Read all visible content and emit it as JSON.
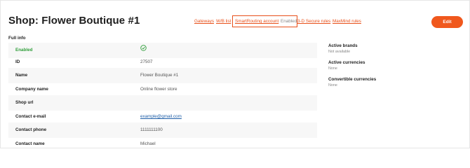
{
  "header": {
    "title": "Shop: Flower Boutique #1",
    "edit_label": "Edit"
  },
  "links": {
    "gateways": "Gateways",
    "wb_list": "W/B list",
    "smartrouting": "SmartRouting account",
    "smartrouting_status": "Enabled",
    "secure_rules": "3-D Secure rules",
    "maxmind_rules": "MaxMind rules"
  },
  "full_info": {
    "title": "Full info",
    "rows": [
      {
        "label": "Enabled",
        "value": "",
        "icon": "check-circle-icon"
      },
      {
        "label": "ID",
        "value": "27507"
      },
      {
        "label": "Name",
        "value": "Flower Boutique #1"
      },
      {
        "label": "Company name",
        "value": "Online flower store"
      },
      {
        "label": "Shop url",
        "value": ""
      },
      {
        "label": "Contact e-mail",
        "value": "example@gmail.com"
      },
      {
        "label": "Contact phone",
        "value": "1111111100"
      },
      {
        "label": "Contact name",
        "value": "Michael"
      }
    ]
  },
  "side_info": {
    "active_brands": {
      "title": "Active brands",
      "value": "Not available"
    },
    "active_currencies": {
      "title": "Active currencies",
      "value": "None"
    },
    "convertible_currencies": {
      "title": "Convertible currencies",
      "value": "None"
    }
  },
  "colors": {
    "accent": "#f0581d",
    "enabled_green": "#2f9e3a",
    "link_blue": "#1f5fa8"
  }
}
